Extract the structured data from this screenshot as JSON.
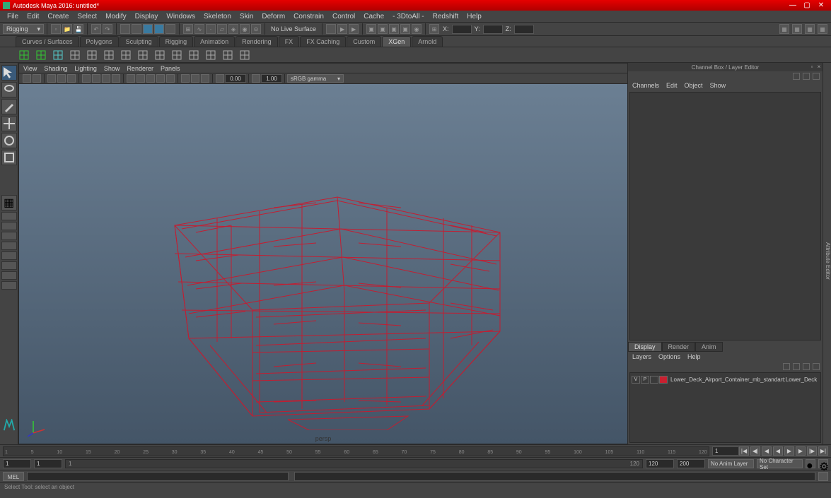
{
  "title": "Autodesk Maya 2016: untitled*",
  "menu": [
    "File",
    "Edit",
    "Create",
    "Select",
    "Modify",
    "Display",
    "Windows",
    "Skeleton",
    "Skin",
    "Deform",
    "Constrain",
    "Control",
    "Cache",
    "- 3DtoAll -",
    "Redshift",
    "Help"
  ],
  "workspace": "Rigging",
  "no_live_surface": "No Live Surface",
  "coords": {
    "x": "X:",
    "y": "Y:",
    "z": "Z:"
  },
  "shelf_tabs": [
    "Curves / Surfaces",
    "Polygons",
    "Sculpting",
    "Rigging",
    "Animation",
    "Rendering",
    "FX",
    "FX Caching",
    "Custom",
    "XGen",
    "Arnold"
  ],
  "active_shelf_tab": "XGen",
  "panel_menu": [
    "View",
    "Shading",
    "Lighting",
    "Show",
    "Renderer",
    "Panels"
  ],
  "exposure": "0.00",
  "gamma": "1.00",
  "colorspace": "sRGB gamma",
  "persp": "persp",
  "channelbox_title": "Channel Box / Layer Editor",
  "channel_menu": [
    "Channels",
    "Edit",
    "Object",
    "Show"
  ],
  "layer_tabs": [
    "Display",
    "Render",
    "Anim"
  ],
  "layer_menu": [
    "Layers",
    "Options",
    "Help"
  ],
  "layer_v": "V",
  "layer_p": "P",
  "layer_item": "Lower_Deck_Airport_Container_mb_standart:Lower_Deck",
  "side_tabs": [
    "Attribute Editor",
    "Channel Box / Layer Editor"
  ],
  "time_ticks": [
    "1",
    "5",
    "10",
    "15",
    "20",
    "25",
    "30",
    "35",
    "40",
    "45",
    "50",
    "55",
    "60",
    "65",
    "70",
    "75",
    "80",
    "85",
    "90",
    "95",
    "100",
    "105",
    "110",
    "115",
    "120"
  ],
  "current_frame": "1",
  "range_start_out": "1",
  "range_start_in": "1",
  "range_bar_start": "1",
  "range_bar_end": "120",
  "range_end_in": "120",
  "range_end_out": "200",
  "anim_layer": "No Anim Layer",
  "char_set": "No Character Set",
  "cmd_lang": "MEL",
  "helpline": "Select Tool: select an object"
}
